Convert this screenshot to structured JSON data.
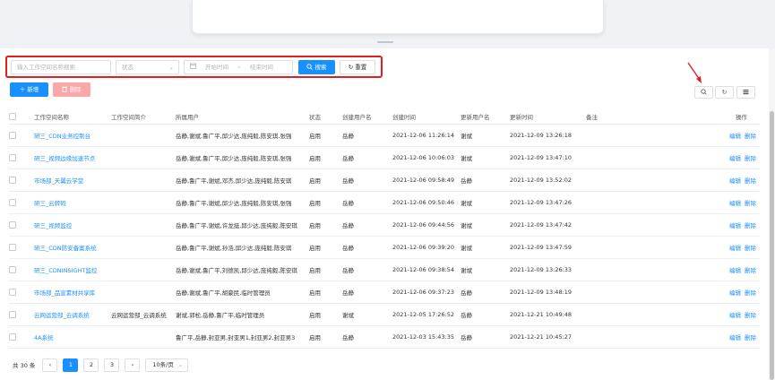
{
  "filters": {
    "name_placeholder": "输入工作空间名称搜索",
    "status_placeholder": "状态",
    "start_placeholder": "开始时间",
    "range_sep": "~",
    "end_placeholder": "结束时间",
    "search_label": "搜索",
    "reset_label": "重置"
  },
  "toolbar": {
    "add_label": "新增",
    "delete_label": "删除"
  },
  "icons": {
    "search": "search-icon",
    "refresh": "refresh-icon",
    "columns": "columns-icon",
    "calendar": "calendar-icon"
  },
  "colors": {
    "primary": "#1890ff",
    "danger": "#f9a7a7",
    "highlight": "#e02020"
  },
  "table": {
    "headers": [
      "工作空间名称",
      "工作空间简介",
      "所属用户",
      "状态",
      "创建用户名",
      "创建时间",
      "更新用户名",
      "更新时间",
      "备注",
      "操作"
    ],
    "edit_label": "编辑",
    "delete_label": "删除",
    "rows": [
      {
        "name": "研三_CDN业务控制台",
        "intro": "",
        "users": "岳静,谢斌,鲁广平,邱少达,庞纯毅,陈安琪,张强",
        "status": "启用",
        "creator": "岳静",
        "created": "2021-12-06 11:26:14",
        "updater": "谢斌",
        "updated": "2021-12-09 13:26:18",
        "remark": ""
      },
      {
        "name": "研三_视频边缘加速节点",
        "intro": "",
        "users": "岳静,谢斌,鲁广平,邱少达,庞纯毅,陈安琪,张强",
        "status": "启用",
        "creator": "岳静",
        "created": "2021-12-06 10:06:03",
        "updater": "谢斌",
        "updated": "2021-12-09 13:47:10",
        "remark": ""
      },
      {
        "name": "市场部_天翼云学堂",
        "intro": "",
        "users": "岳静,鲁广平,谢斌,邓杰,邱少达,庞纯毅,陈安琪",
        "status": "启用",
        "creator": "岳静",
        "created": "2021-12-06 09:58:49",
        "updater": "岳静",
        "updated": "2021-12-09 13:52:02",
        "remark": ""
      },
      {
        "name": "研三_云转码",
        "intro": "",
        "users": "岳静,鲁广平,谢斌,邱少达,庞纯毅,陈安琪,张强",
        "status": "启用",
        "creator": "岳静",
        "created": "2021-12-06 09:50:46",
        "updater": "谢斌",
        "updated": "2021-12-09 13:47:26",
        "remark": ""
      },
      {
        "name": "研三_视频监控",
        "intro": "",
        "users": "岳静,鲁广平,谢斌,许龙挺,邱少达,庞纯毅,陈安琪",
        "status": "启用",
        "creator": "岳静",
        "created": "2021-12-06 09:44:56",
        "updater": "谢斌",
        "updated": "2021-12-09 13:47:42",
        "remark": ""
      },
      {
        "name": "研三_CDN防安备案系统",
        "intro": "",
        "users": "岳静,鲁广平,谢斌,孙浩,邱少达,庞纯毅,陈安琪",
        "status": "启用",
        "creator": "岳静",
        "created": "2021-12-06 09:39:20",
        "updater": "谢斌",
        "updated": "2021-12-09 13:47:59",
        "remark": ""
      },
      {
        "name": "研三_CDNINSIGHT监控",
        "intro": "",
        "users": "岳静,谢斌,鲁广平,刘德凯,邱少达,庞纯毅,陈安琪",
        "status": "启用",
        "creator": "岳静",
        "created": "2021-12-06 09:38:54",
        "updater": "谢斌",
        "updated": "2021-12-09 13:26:33",
        "remark": ""
      },
      {
        "name": "市场部_品宣素材共享库",
        "intro": "",
        "users": "岳静,谢斌,鲁广平,胡豪民,临时管理员",
        "status": "启用",
        "creator": "岳静",
        "created": "2021-12-06 09:37:23",
        "updater": "岳静",
        "updated": "2021-12-09 13:48:19",
        "remark": ""
      },
      {
        "name": "云网运营部_云调系统",
        "intro": "云网运营部_云调系统",
        "users": "谢斌,郭松,岳静,鲁广平,临时管理员",
        "status": "启用",
        "creator": "谢斌",
        "created": "2021-12-05 17:26:52",
        "updater": "岳静",
        "updated": "2021-12-21 10:49:48",
        "remark": ""
      },
      {
        "name": "4A系统",
        "intro": "",
        "users": "鲁广平,岳静,封亚男,封亚男1,封亚男2,封亚男3",
        "status": "启用",
        "creator": "岳静",
        "created": "2021-12-03 15:43:35",
        "updater": "岳静",
        "updated": "2021-12-21 10:45:27",
        "remark": ""
      }
    ]
  },
  "pagination": {
    "total": "共 30 条",
    "prev": "‹",
    "pages": [
      "1",
      "2",
      "3"
    ],
    "current": "1",
    "next": "›",
    "page_size": "10条/页"
  }
}
